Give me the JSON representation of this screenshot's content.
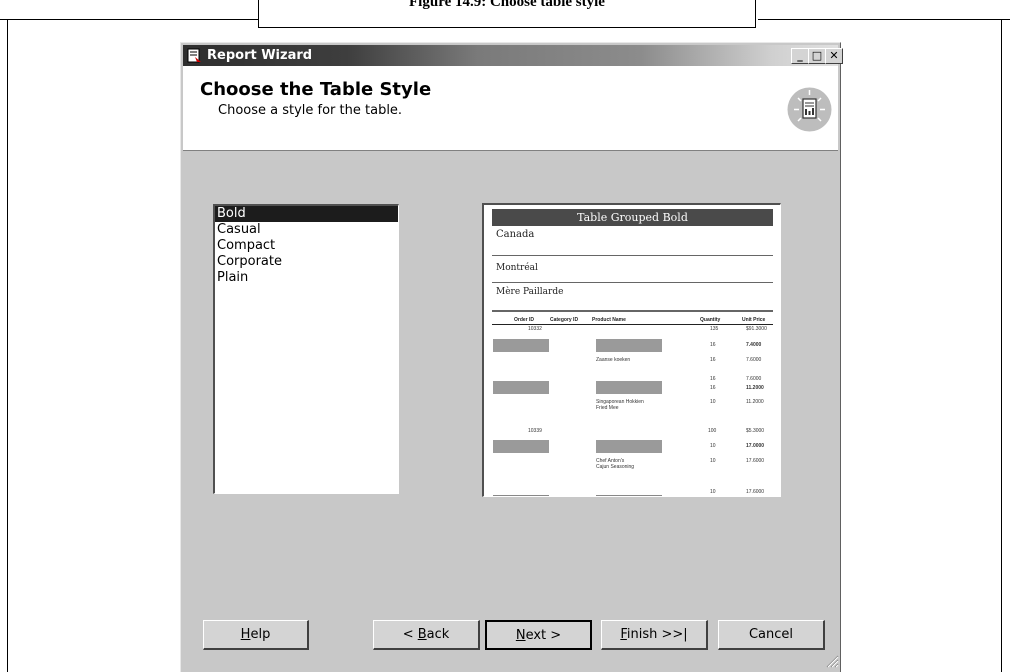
{
  "figure": {
    "caption": "Figure 14.9: Choose table style"
  },
  "window": {
    "title": "Report Wizard",
    "controls": {
      "minimize": "_",
      "maximize": "□",
      "close": "✕"
    }
  },
  "header": {
    "title": "Choose the Table Style",
    "subtitle": "Choose a style for the table."
  },
  "style_list": {
    "items": [
      "Bold",
      "Casual",
      "Compact",
      "Corporate",
      "Plain"
    ],
    "selected": "Bold"
  },
  "preview": {
    "title": "Table Grouped Bold",
    "groups": [
      "Canada",
      "Montréal",
      "Mère Paillarde"
    ],
    "columns": [
      "Order ID",
      "Category ID",
      "Product Name",
      "Quantity",
      "Unit Price"
    ],
    "rows": [
      {
        "order": "10332",
        "cat": "",
        "product": "",
        "qty": "135",
        "price": "$91.3000"
      },
      {
        "order": "",
        "cat": "",
        "product": "",
        "qty": "16",
        "price": "7.4000"
      },
      {
        "order": "",
        "cat": "",
        "product": "Zaanse koeken",
        "qty": "16",
        "price": "7.6000"
      },
      {
        "order": "",
        "cat": "",
        "product": "",
        "qty": "16",
        "price": "7.6000"
      },
      {
        "order": "",
        "cat": "",
        "product": "",
        "qty": "16",
        "price": "11.2000"
      },
      {
        "order": "",
        "cat": "",
        "product": "Singaporean Hokkien Fried Mee",
        "qty": "10",
        "price": "11.2000"
      },
      {
        "order": "10339",
        "cat": "",
        "product": "",
        "qty": "100",
        "price": "$5.3000"
      },
      {
        "order": "",
        "cat": "",
        "product": "",
        "qty": "10",
        "price": "17.0000"
      },
      {
        "order": "",
        "cat": "",
        "product": "Chef Anton's Cajun Seasoning",
        "qty": "10",
        "price": "17.6000"
      },
      {
        "order": "",
        "cat": "",
        "product": "",
        "qty": "10",
        "price": "17.6000"
      }
    ]
  },
  "buttons": {
    "help": {
      "label": "Help",
      "mnemonic": "H"
    },
    "back": {
      "label": "< Back",
      "mnemonic": "B"
    },
    "next": {
      "label": "Next >",
      "mnemonic": "N"
    },
    "finish": {
      "label": "Finish >>|",
      "mnemonic": "F"
    },
    "cancel": {
      "label": "Cancel"
    }
  }
}
